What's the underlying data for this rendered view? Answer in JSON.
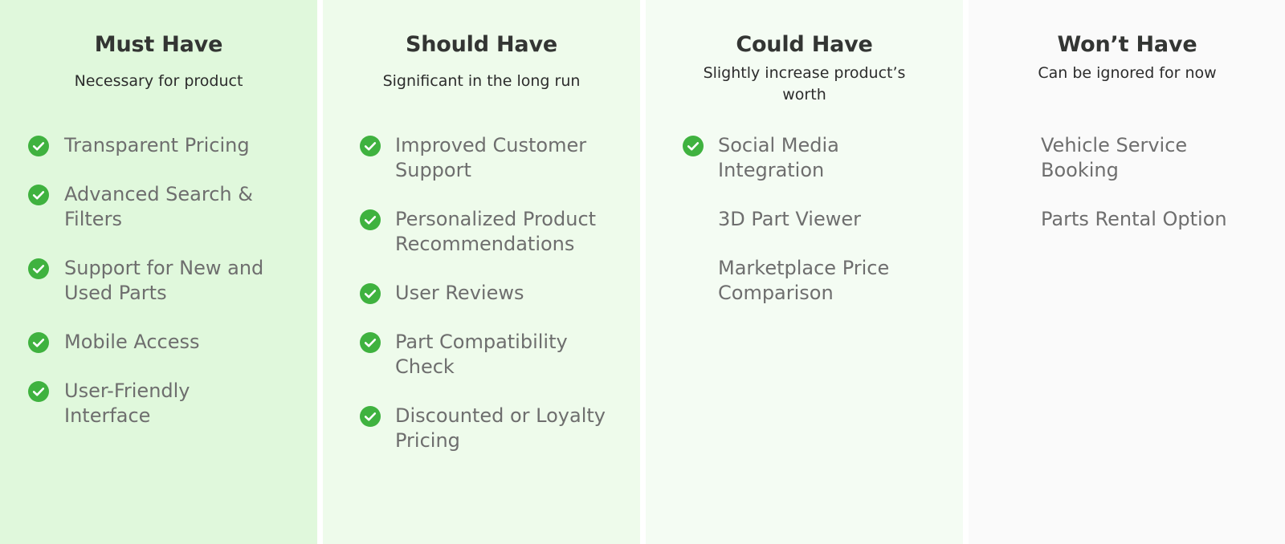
{
  "colors": {
    "check": "#3fb23f",
    "title": "#333533",
    "subtitle": "#2c2c2c",
    "item": "#6e6e6e",
    "must_bg": "#e0f8dc",
    "should_bg": "#eefbeb",
    "could_bg": "#f4fcf3",
    "wont_bg": "#fafafa"
  },
  "columns": [
    {
      "title": "Must Have",
      "subtitle": "Necessary for product",
      "items": [
        {
          "label": "Transparent Pricing",
          "checked": true,
          "icon": "check-circle-icon"
        },
        {
          "label": "Advanced Search & Filters",
          "checked": true,
          "icon": "check-circle-icon"
        },
        {
          "label": "Support for New and Used Parts",
          "checked": true,
          "icon": "check-circle-icon"
        },
        {
          "label": "Mobile Access",
          "checked": true,
          "icon": "check-circle-icon"
        },
        {
          "label": "User-Friendly Interface",
          "checked": true,
          "icon": "check-circle-icon"
        }
      ]
    },
    {
      "title": "Should Have",
      "subtitle": "Significant in the long run",
      "items": [
        {
          "label": "Improved Customer Support",
          "checked": true,
          "icon": "check-circle-icon"
        },
        {
          "label": "Personalized Product Recommendations",
          "checked": true,
          "icon": "check-circle-icon"
        },
        {
          "label": "User Reviews",
          "checked": true,
          "icon": "check-circle-icon"
        },
        {
          "label": "Part Compatibility Check",
          "checked": true,
          "icon": "check-circle-icon"
        },
        {
          "label": "Discounted or Loyalty Pricing",
          "checked": true,
          "icon": "check-circle-icon"
        }
      ]
    },
    {
      "title": "Could Have",
      "subtitle": "Slightly increase product’s worth",
      "items": [
        {
          "label": "Social Media Integration",
          "checked": true,
          "icon": "check-circle-icon"
        },
        {
          "label": "3D Part Viewer",
          "checked": false
        },
        {
          "label": "Marketplace Price Comparison",
          "checked": false
        }
      ]
    },
    {
      "title": "Won’t Have",
      "subtitle": "Can be ignored for now",
      "items": [
        {
          "label": "Vehicle Service Booking",
          "checked": false
        },
        {
          "label": "Parts Rental Option",
          "checked": false
        }
      ]
    }
  ]
}
